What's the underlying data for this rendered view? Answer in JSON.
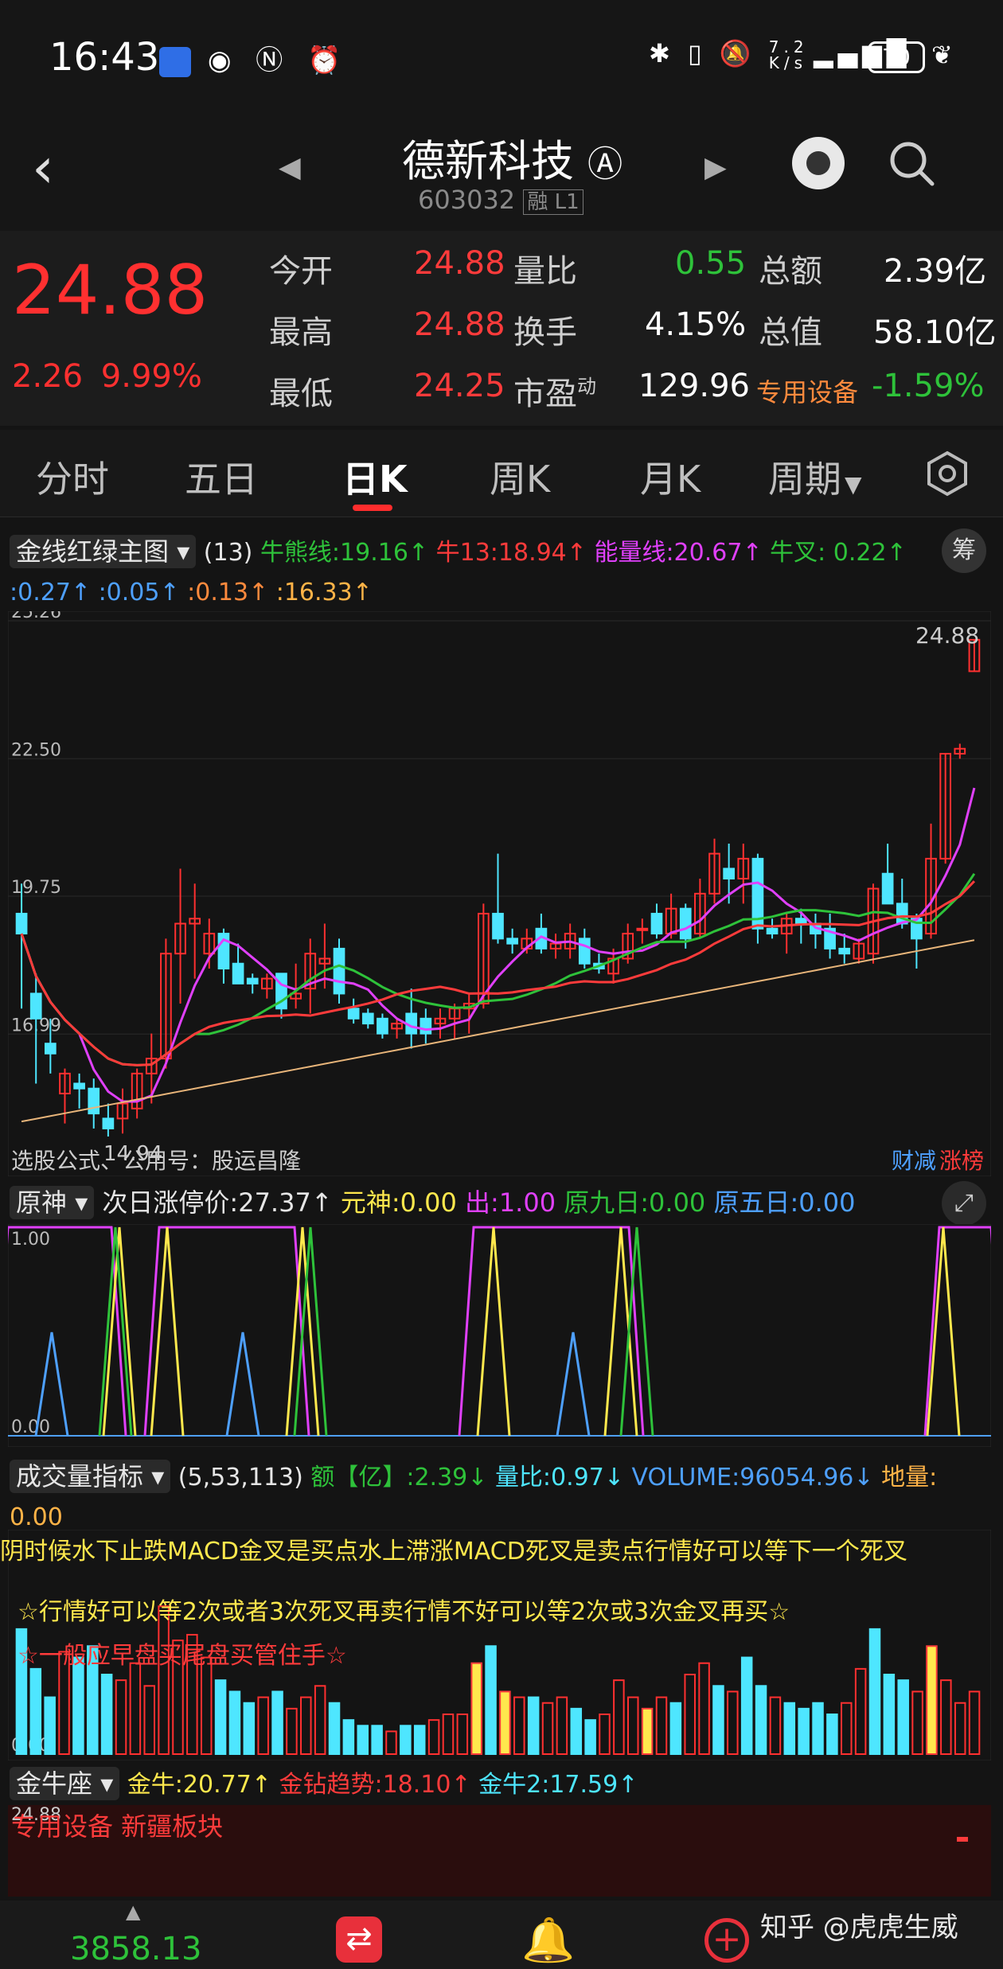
{
  "status_bar": {
    "time": "16:43",
    "network_speed": "7.2\nK/s",
    "battery": "70",
    "icons": [
      "app-badge-icon",
      "eye-icon",
      "nfc-icon",
      "alarm-icon",
      "bluetooth-icon",
      "vibrate-icon",
      "mute-icon",
      "signal-icon",
      "leaf-icon"
    ]
  },
  "header": {
    "stock_name": "德新科技",
    "stock_badge": "Ⓐ",
    "stock_code": "603032",
    "code_tags": "融 L1"
  },
  "quote": {
    "price": "24.88",
    "change": "2.26",
    "change_pct": "9.99%",
    "rows": [
      {
        "l1": "今开",
        "v1": "24.88",
        "l2": "量比",
        "v2": "0.55",
        "l3": "总额",
        "v3": "2.39亿"
      },
      {
        "l1": "最高",
        "v1": "24.88",
        "l2": "换手",
        "v2": "4.15%",
        "l3": "总值",
        "v3": "58.10亿"
      },
      {
        "l1": "最低",
        "v1": "24.25",
        "l2": "市盈",
        "l2_sup": "动",
        "v2": "129.96",
        "l3": "专用设备",
        "v3": "-1.59%"
      }
    ]
  },
  "tabs": [
    "分时",
    "五日",
    "日K",
    "周K",
    "月K",
    "周期"
  ],
  "active_tab": "日K",
  "main_indicator": {
    "name": "金线红绿主图",
    "param": "(13)",
    "items": [
      {
        "text": "牛熊线:19.16↑",
        "color": "#2ec23a"
      },
      {
        "text": "牛13:18.94↑",
        "color": "#ff3b3b"
      },
      {
        "text": "能量线:20.67↑",
        "color": "#e040fb"
      },
      {
        "text": "牛叉:",
        "color": "#2ec23a"
      },
      {
        "text": "0.22↑",
        "color": "#2ec23a"
      },
      {
        "text": ":0.27↑",
        "color": "#4ea0ff"
      },
      {
        "text": ":0.05↑",
        "color": "#4ea0ff"
      },
      {
        "text": ":0.13↑",
        "color": "#ff8a3d"
      },
      {
        "text": ":16.33↑",
        "color": "#ffb347"
      }
    ],
    "chips_label": "筹",
    "y_labels": [
      "25.26",
      "22.50",
      "19.75",
      "16.99"
    ],
    "high_label": "24.88",
    "low_label": "14.94",
    "footer_text": "选股公式、公用号：股运昌隆",
    "tag_1": "财减",
    "tag_2": "涨榜"
  },
  "indicator_1": {
    "name": "原神",
    "items": [
      {
        "text": "次日涨停价:27.37↑",
        "color": "#e6e6e6"
      },
      {
        "text": "元神:0.00",
        "color": "#ffe84d"
      },
      {
        "text": "出:1.00",
        "color": "#e040fb"
      },
      {
        "text": "原九日:0.00",
        "color": "#2ec23a"
      },
      {
        "text": "原五日:0.00",
        "color": "#4ea0ff"
      }
    ],
    "y_top": "1.00",
    "y_bottom": "0.00"
  },
  "volume": {
    "name": "成交量指标",
    "param": "(5,53,113)",
    "items": [
      {
        "text": "额【亿】:2.39↓",
        "color": "#2ec23a"
      },
      {
        "text": "量比:0.97↓",
        "color": "#4ee6ff"
      },
      {
        "text": "VOLUME:96054.96↓",
        "color": "#4ea0ff"
      },
      {
        "text": "地量:",
        "color": "#ffb347"
      },
      {
        "text": "0.00",
        "color": "#ffb347"
      }
    ],
    "scroll_text": "阴时候水下止跌MACD金叉是买点水上滞涨MACD死叉是卖点行情好可以等下一个死叉",
    "note_1": "☆行情好可以等2次或者3次死叉再卖行情不好可以等2次或3次金叉再买☆",
    "note_2": "☆一般应早盘买尾盘买管住手☆",
    "y_bottom": "0.00"
  },
  "gold_bull": {
    "name": "金牛座",
    "items": [
      {
        "text": "金牛:20.77↑",
        "color": "#ffe84d"
      },
      {
        "text": "金钻趋势:18.10↑",
        "color": "#ff3b3b"
      },
      {
        "text": "金牛2:17.59↑",
        "color": "#4ee6ff"
      }
    ],
    "y_label": "24.88",
    "sector_text": "专用设备 新疆板块"
  },
  "bottom_nav": {
    "index_value": "3858.13",
    "watermark": "知乎 @虎虎生威"
  },
  "colors": {
    "up": "#ff3030",
    "down": "#2ec23a",
    "candle_down": "#4ee6ff",
    "background": "#141414"
  },
  "chart_data": [
    {
      "type": "candlestick",
      "title": "金线红绿主图",
      "ylim": [
        14.94,
        25.26
      ],
      "y_ticks": [
        25.26,
        22.5,
        19.75,
        16.99
      ],
      "candles": [
        {
          "o": 19.4,
          "h": 20.0,
          "l": 17.5,
          "c": 19.0
        },
        {
          "o": 17.8,
          "h": 18.2,
          "l": 16.0,
          "c": 17.3
        },
        {
          "o": 16.8,
          "h": 17.3,
          "l": 16.2,
          "c": 16.6
        },
        {
          "o": 15.8,
          "h": 16.3,
          "l": 15.2,
          "c": 16.2
        },
        {
          "o": 16.0,
          "h": 16.2,
          "l": 15.5,
          "c": 15.9
        },
        {
          "o": 15.9,
          "h": 16.1,
          "l": 15.1,
          "c": 15.4
        },
        {
          "o": 15.3,
          "h": 15.6,
          "l": 14.94,
          "c": 15.1
        },
        {
          "o": 15.3,
          "h": 15.9,
          "l": 15.0,
          "c": 15.6
        },
        {
          "o": 15.5,
          "h": 16.3,
          "l": 15.3,
          "c": 16.2
        },
        {
          "o": 16.2,
          "h": 17.0,
          "l": 15.6,
          "c": 16.5
        },
        {
          "o": 16.5,
          "h": 18.9,
          "l": 16.3,
          "c": 18.6
        },
        {
          "o": 18.6,
          "h": 20.3,
          "l": 17.6,
          "c": 19.2
        },
        {
          "o": 19.2,
          "h": 20.0,
          "l": 18.1,
          "c": 19.3
        },
        {
          "o": 18.6,
          "h": 19.3,
          "l": 18.3,
          "c": 19.0
        },
        {
          "o": 19.0,
          "h": 19.1,
          "l": 18.0,
          "c": 18.3
        },
        {
          "o": 18.4,
          "h": 18.8,
          "l": 18.1,
          "c": 18.0
        },
        {
          "o": 18.1,
          "h": 18.2,
          "l": 17.8,
          "c": 18.0
        },
        {
          "o": 17.9,
          "h": 18.2,
          "l": 17.7,
          "c": 18.1
        },
        {
          "o": 18.2,
          "h": 18.2,
          "l": 17.3,
          "c": 17.5
        },
        {
          "o": 17.7,
          "h": 18.4,
          "l": 17.5,
          "c": 17.8
        },
        {
          "o": 17.9,
          "h": 18.9,
          "l": 17.4,
          "c": 18.6
        },
        {
          "o": 18.4,
          "h": 19.2,
          "l": 17.9,
          "c": 18.5
        },
        {
          "o": 18.7,
          "h": 18.9,
          "l": 17.6,
          "c": 17.8
        },
        {
          "o": 17.5,
          "h": 17.7,
          "l": 17.2,
          "c": 17.3
        },
        {
          "o": 17.4,
          "h": 17.5,
          "l": 17.1,
          "c": 17.2
        },
        {
          "o": 17.3,
          "h": 17.4,
          "l": 16.9,
          "c": 17.0
        },
        {
          "o": 17.1,
          "h": 17.3,
          "l": 16.9,
          "c": 17.2
        },
        {
          "o": 17.4,
          "h": 17.9,
          "l": 16.7,
          "c": 17.0
        },
        {
          "o": 17.3,
          "h": 17.5,
          "l": 16.8,
          "c": 17.0
        },
        {
          "o": 17.2,
          "h": 17.5,
          "l": 16.9,
          "c": 17.3
        },
        {
          "o": 17.3,
          "h": 17.6,
          "l": 16.9,
          "c": 17.5
        },
        {
          "o": 17.5,
          "h": 17.8,
          "l": 17.0,
          "c": 17.6
        },
        {
          "o": 17.6,
          "h": 19.6,
          "l": 17.5,
          "c": 19.4
        },
        {
          "o": 19.4,
          "h": 20.6,
          "l": 18.8,
          "c": 18.9
        },
        {
          "o": 18.9,
          "h": 19.1,
          "l": 18.6,
          "c": 18.8
        },
        {
          "o": 18.7,
          "h": 19.1,
          "l": 18.6,
          "c": 18.9
        },
        {
          "o": 19.1,
          "h": 19.4,
          "l": 18.6,
          "c": 18.7
        },
        {
          "o": 18.7,
          "h": 19.0,
          "l": 18.5,
          "c": 18.8
        },
        {
          "o": 18.7,
          "h": 19.2,
          "l": 18.5,
          "c": 19.0
        },
        {
          "o": 18.9,
          "h": 19.1,
          "l": 18.3,
          "c": 18.4
        },
        {
          "o": 18.4,
          "h": 18.6,
          "l": 18.2,
          "c": 18.3
        },
        {
          "o": 18.2,
          "h": 18.7,
          "l": 18.0,
          "c": 18.5
        },
        {
          "o": 18.5,
          "h": 19.2,
          "l": 18.4,
          "c": 19.0
        },
        {
          "o": 19.1,
          "h": 19.3,
          "l": 18.8,
          "c": 19.1
        },
        {
          "o": 19.4,
          "h": 19.6,
          "l": 18.9,
          "c": 19.0
        },
        {
          "o": 19.0,
          "h": 19.8,
          "l": 18.9,
          "c": 19.5
        },
        {
          "o": 19.5,
          "h": 19.6,
          "l": 18.7,
          "c": 18.9
        },
        {
          "o": 19.0,
          "h": 20.1,
          "l": 18.9,
          "c": 19.8
        },
        {
          "o": 19.8,
          "h": 20.9,
          "l": 19.6,
          "c": 20.6
        },
        {
          "o": 20.3,
          "h": 20.8,
          "l": 19.6,
          "c": 20.1
        },
        {
          "o": 20.1,
          "h": 20.8,
          "l": 19.6,
          "c": 20.5
        },
        {
          "o": 20.5,
          "h": 20.6,
          "l": 18.8,
          "c": 19.1
        },
        {
          "o": 19.1,
          "h": 19.3,
          "l": 18.9,
          "c": 19.0
        },
        {
          "o": 19.0,
          "h": 19.4,
          "l": 18.6,
          "c": 19.3
        },
        {
          "o": 19.3,
          "h": 19.5,
          "l": 18.8,
          "c": 19.2
        },
        {
          "o": 19.2,
          "h": 19.4,
          "l": 18.7,
          "c": 19.0
        },
        {
          "o": 19.1,
          "h": 19.4,
          "l": 18.5,
          "c": 18.7
        },
        {
          "o": 18.7,
          "h": 19.0,
          "l": 18.4,
          "c": 18.6
        },
        {
          "o": 18.5,
          "h": 18.9,
          "l": 18.4,
          "c": 18.8
        },
        {
          "o": 18.6,
          "h": 20.0,
          "l": 18.4,
          "c": 19.9
        },
        {
          "o": 20.2,
          "h": 20.8,
          "l": 19.8,
          "c": 19.6
        },
        {
          "o": 19.6,
          "h": 20.1,
          "l": 19.1,
          "c": 19.2
        },
        {
          "o": 19.3,
          "h": 19.4,
          "l": 18.3,
          "c": 18.9
        },
        {
          "o": 19.0,
          "h": 21.2,
          "l": 18.9,
          "c": 20.5
        },
        {
          "o": 20.5,
          "h": 22.6,
          "l": 20.4,
          "c": 22.6
        },
        {
          "o": 22.6,
          "h": 22.8,
          "l": 22.5,
          "c": 22.7
        },
        {
          "o": 24.25,
          "h": 24.88,
          "l": 24.25,
          "c": 24.88
        }
      ],
      "series": [
        {
          "name": "牛熊线",
          "color": "#2ec23a",
          "last": 19.16
        },
        {
          "name": "牛13",
          "color": "#ff3b3b",
          "last": 18.94
        },
        {
          "name": "能量线",
          "color": "#e040fb",
          "last": 20.67
        }
      ]
    },
    {
      "type": "line",
      "title": "原神",
      "ylim": [
        0,
        1
      ],
      "series": [
        {
          "name": "出",
          "color": "#e040fb"
        },
        {
          "name": "元神",
          "color": "#ffe84d"
        },
        {
          "name": "原九日",
          "color": "#2ec23a"
        },
        {
          "name": "原五日",
          "color": "#4ea0ff"
        }
      ]
    },
    {
      "type": "bar",
      "title": "成交量指标",
      "values": [
        2.2,
        1.5,
        1.0,
        1.8,
        1.7,
        1.9,
        1.4,
        1.3,
        1.6,
        1.2,
        2.6,
        2.0,
        2.1,
        1.7,
        1.3,
        1.1,
        0.9,
        1.0,
        1.1,
        0.8,
        1.0,
        1.2,
        0.9,
        0.6,
        0.5,
        0.5,
        0.4,
        0.5,
        0.5,
        0.6,
        0.7,
        0.7,
        1.6,
        1.9,
        1.1,
        1.0,
        1.0,
        0.9,
        1.0,
        0.8,
        0.6,
        0.7,
        1.3,
        1.0,
        0.8,
        1.0,
        0.9,
        1.4,
        1.6,
        1.2,
        1.1,
        1.7,
        1.2,
        1.0,
        0.9,
        0.8,
        0.9,
        0.7,
        0.9,
        1.5,
        2.2,
        1.4,
        1.3,
        1.1,
        1.9,
        1.3,
        0.9,
        1.1
      ],
      "highlight": [
        32,
        34,
        44,
        64
      ]
    }
  ]
}
